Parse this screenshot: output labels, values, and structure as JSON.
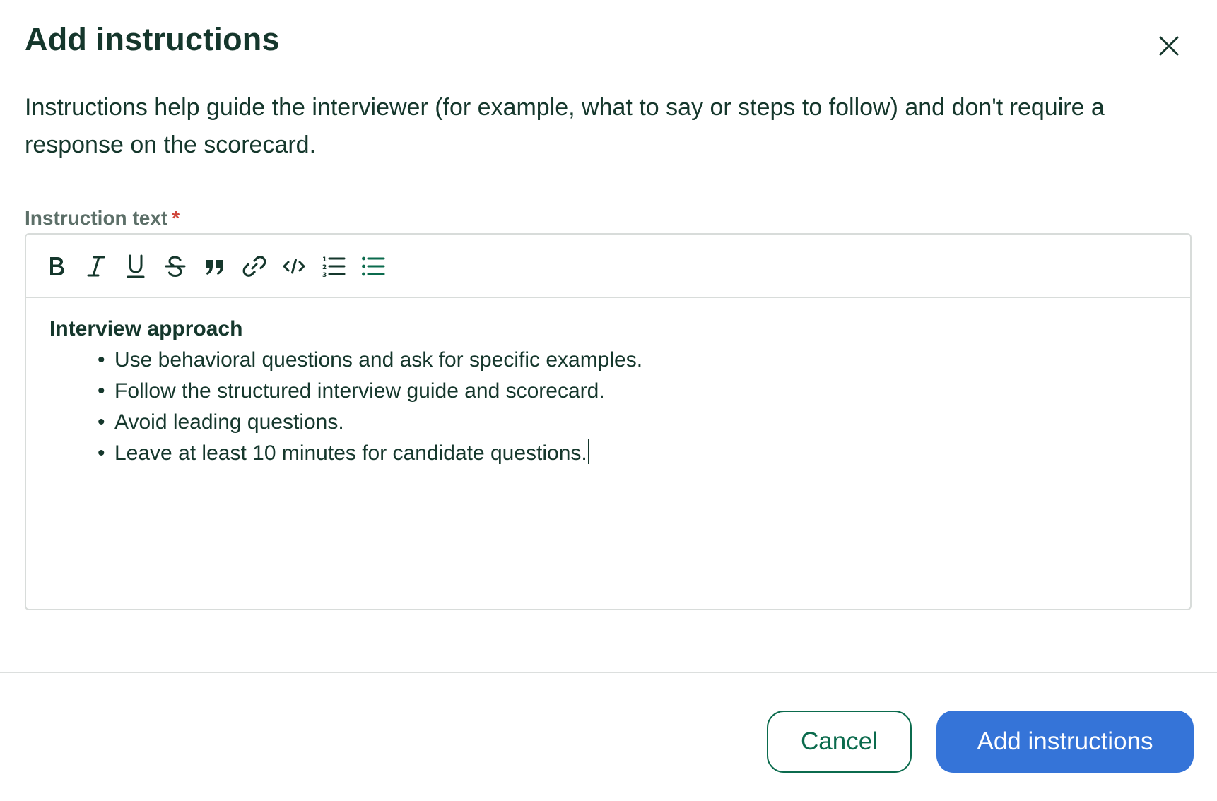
{
  "dialog": {
    "title": "Add instructions",
    "description": "Instructions help guide the interviewer (for example, what to say or steps to follow) and don't require a response on the scorecard.",
    "field_label": "Instruction text",
    "required_marker": "*"
  },
  "toolbar": {
    "tools": [
      {
        "icon": "bold-icon"
      },
      {
        "icon": "italic-icon"
      },
      {
        "icon": "underline-icon"
      },
      {
        "icon": "strikethrough-icon"
      },
      {
        "icon": "blockquote-icon"
      },
      {
        "icon": "link-icon"
      },
      {
        "icon": "code-icon"
      },
      {
        "icon": "ordered-list-icon"
      },
      {
        "icon": "bullet-list-icon",
        "active": true
      }
    ]
  },
  "editor": {
    "heading": "Interview approach",
    "items": [
      "Use behavioral questions and ask for specific examples.",
      "Follow the structured interview guide and scorecard.",
      "Avoid leading questions.",
      "Leave at least 10 minutes for candidate questions."
    ]
  },
  "footer": {
    "cancel_label": "Cancel",
    "submit_label": "Add instructions"
  },
  "colors": {
    "text": "#15372c",
    "label": "#5c6f68",
    "required": "#d0463b",
    "accent_green": "#0b6b4d",
    "primary": "#3574d8",
    "border": "#d8dcda"
  }
}
